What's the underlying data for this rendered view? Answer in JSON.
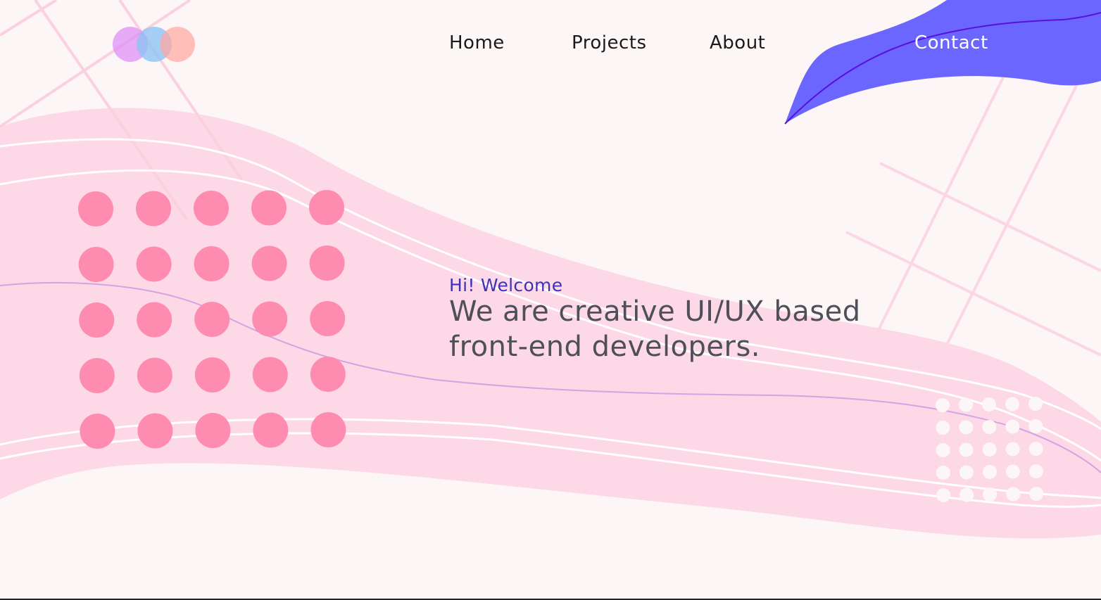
{
  "logo": {
    "colors": [
      "#e3a4f7",
      "#9fc7f2",
      "#ffb3b0"
    ]
  },
  "nav": {
    "items": [
      {
        "label": "Home"
      },
      {
        "label": "Projects"
      },
      {
        "label": "About"
      },
      {
        "label": "Contact"
      }
    ]
  },
  "hero": {
    "greeting": "Hi! Welcome",
    "headline_line1": "We are creative UI/UX based",
    "headline_line2": "front-end developers."
  },
  "colors": {
    "background": "#fdf6f6",
    "wave": "#fdd8e6",
    "dots_pink": "#fd8cb0",
    "dots_white": "#fdf6f6",
    "contact_blob": "#6b66ff",
    "accent_text": "#3d33b8",
    "lines_light": "#fcd6e3"
  }
}
